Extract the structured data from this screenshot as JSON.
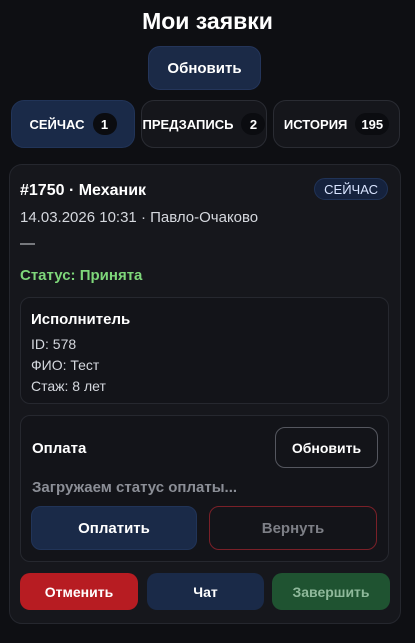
{
  "header": {
    "title": "Мои заявки",
    "refresh_label": "Обновить"
  },
  "tabs": [
    {
      "label": "СЕЙЧАС",
      "count": "1",
      "active": true
    },
    {
      "label": "ПРЕДЗАПИСЬ",
      "count": "2",
      "active": false
    },
    {
      "label": "ИСТОРИЯ",
      "count": "195",
      "active": false
    }
  ],
  "order": {
    "title": "#1750 · Механик",
    "badge": "СЕЙЧАС",
    "meta": "14.03.2026 10:31 · Павло-Очаково",
    "description": "—",
    "status": "Статус: Принята",
    "status_color": "#7ed77a",
    "executor": {
      "title": "Исполнитель",
      "id_line": "ID: 578",
      "name_line": "ФИО: Тест",
      "exp_line": "Стаж: 8 лет"
    },
    "payment": {
      "title": "Оплата",
      "refresh_label": "Обновить",
      "loading_text": "Загружаем статус оплаты...",
      "pay_label": "Оплатить",
      "return_label": "Вернуть"
    },
    "actions": {
      "cancel_label": "Отменить",
      "chat_label": "Чат",
      "finish_label": "Завершить"
    }
  },
  "colors": {
    "background": "#0e0f13",
    "accent_blue": "#1a2a48",
    "danger": "#b71c22",
    "success_dark": "#1f5331"
  }
}
